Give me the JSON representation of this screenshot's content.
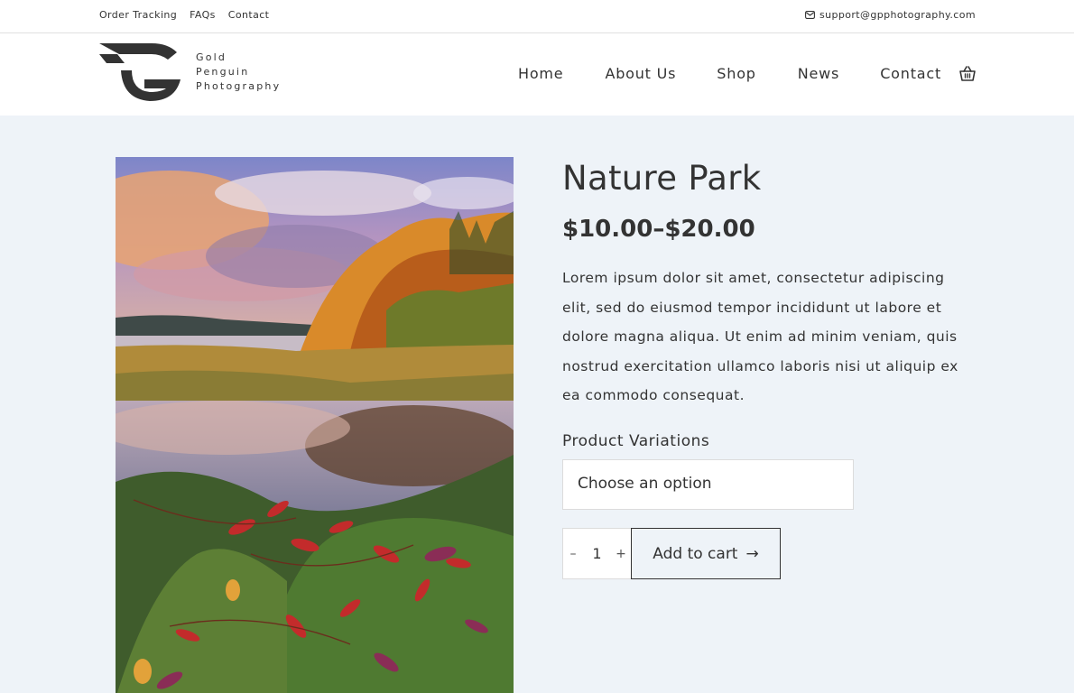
{
  "topbar": {
    "links": [
      "Order Tracking",
      "FAQs",
      "Contact"
    ],
    "support_email": "support@gpphotography.com"
  },
  "brand": {
    "line1": "Gold",
    "line2": "Penguin",
    "line3": "Photography",
    "logo_color": "#333333"
  },
  "nav": {
    "items": [
      "Home",
      "About Us",
      "Shop",
      "News",
      "Contact"
    ]
  },
  "product": {
    "title": "Nature Park",
    "price": "$10.00–$20.00",
    "description": "Lorem ipsum dolor sit amet, consectetur adipiscing elit, sed do eiusmod tempor incididunt ut labore et dolore magna aliqua. Ut enim ad minim veniam, quis nostrud exercitation ullamco laboris nisi ut aliquip ex ea commodo consequat.",
    "variations_label": "Product Variations",
    "select_placeholder": "Choose an option",
    "quantity": "1",
    "minus_label": "–",
    "plus_label": "+",
    "add_to_cart_label": "Add to cart",
    "arrow": "→"
  },
  "icons": [
    "mail-icon",
    "cart-basket-icon",
    "arrow-right-icon"
  ],
  "colors": {
    "page_bg": "#eef3f8",
    "header_bg": "#ffffff",
    "text": "#333333"
  }
}
